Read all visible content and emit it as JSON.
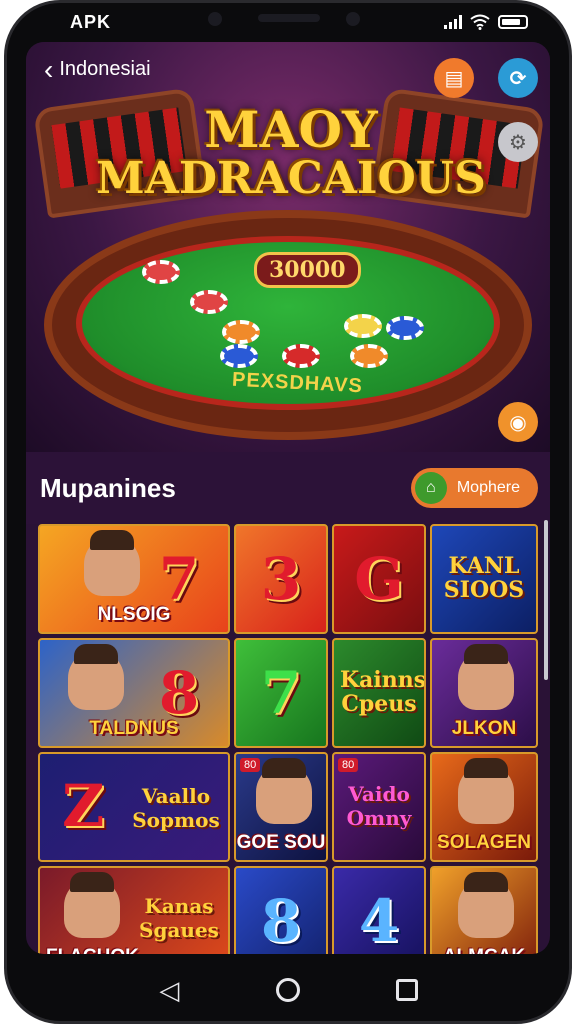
{
  "status_bar": {
    "carrier": "APK"
  },
  "header": {
    "back_label": "Indonesiai"
  },
  "hero": {
    "title_line1": "MAOY",
    "title_line2": "MADRACAIOUS",
    "counter": "30000",
    "felt_label": "PEXSDHAVS"
  },
  "section": {
    "title": "Mupanines",
    "more_label": "Mophere"
  },
  "games": [
    {
      "caption": "NLSOIG",
      "big": "7"
    },
    {
      "caption": "",
      "big": "3"
    },
    {
      "caption": "",
      "big": "G"
    },
    {
      "caption": "",
      "word": "KANL SIOOS"
    },
    {
      "caption": "TALDNUS",
      "big": "8"
    },
    {
      "caption": "",
      "big": "7"
    },
    {
      "caption": "",
      "word": "Kainns Cpeus"
    },
    {
      "caption": "JLKON"
    },
    {
      "caption": "",
      "big": "Z",
      "word": "Vaallo Sopmos"
    },
    {
      "caption": "GOE SOU",
      "badge": "80"
    },
    {
      "caption": "",
      "word": "Vaido Omny",
      "badge": "80"
    },
    {
      "caption": "SOLAGEN"
    },
    {
      "caption": "FLACHOK",
      "word": "Kanas Sgaues"
    },
    {
      "caption": "",
      "big": "8"
    },
    {
      "caption": "",
      "big": "4"
    },
    {
      "caption": "ALMCAK"
    }
  ],
  "colors": {
    "accent": "#e8792e",
    "background": "#2a1236",
    "gold": "#ffd23c"
  }
}
